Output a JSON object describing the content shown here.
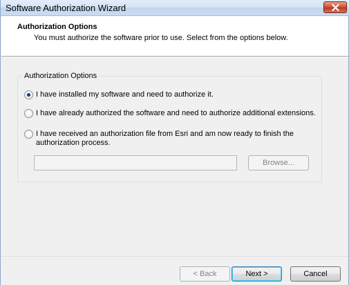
{
  "window": {
    "title": "Software Authorization Wizard"
  },
  "header": {
    "title": "Authorization Options",
    "subtitle": "You must authorize the software prior to use. Select from the options below."
  },
  "group": {
    "legend": "Authorization Options",
    "options": [
      {
        "label": "I have installed my software and need to authorize it.",
        "checked": true
      },
      {
        "label": "I have already authorized the software and need to authorize additional extensions.",
        "checked": false
      },
      {
        "label_line1": "I have received an authorization file from Esri and am now ready to finish the",
        "label_line2": "authorization process.",
        "checked": false
      }
    ],
    "file_path_value": "",
    "browse_label": "Browse..."
  },
  "footer": {
    "back_label": "< Back",
    "next_label": "Next >",
    "cancel_label": "Cancel"
  },
  "colors": {
    "close_button": "#c23a1e",
    "titlebar": "#d3e2f4",
    "header_bg": "#ffffff",
    "dialog_bg": "#f0f0f0"
  },
  "icons": {
    "close": "close-icon"
  }
}
